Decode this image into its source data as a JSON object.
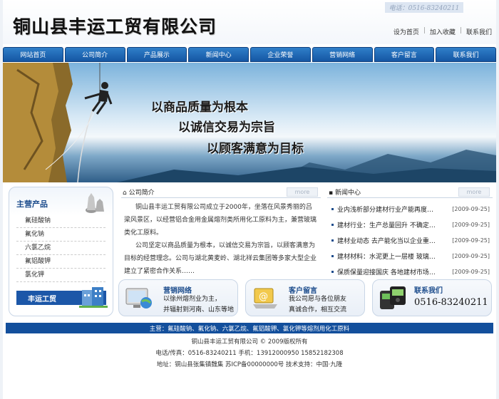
{
  "header": {
    "company_name": "铜山县丰运工贸有限公司",
    "phone_banner": "电话：0516-83240211",
    "top_links": [
      "设为首页",
      "加入收藏",
      "联系我们"
    ]
  },
  "nav": [
    "网站首页",
    "公司简介",
    "产品展示",
    "新闻中心",
    "企业荣誉",
    "营销网络",
    "客户留言",
    "联系我们"
  ],
  "banner": {
    "slogans": [
      "以商品质量为根本",
      "以诚信交易为宗旨",
      "以顾客满意为目标"
    ]
  },
  "products": {
    "title": "主营产品",
    "items": [
      "氟硅酸钠",
      "氟化钠",
      "六氯乙烷",
      "氟铝酸钾",
      "氯化钾"
    ],
    "logo_text": "丰运工贸"
  },
  "intro": {
    "title": "公司简介",
    "more": "more",
    "paragraphs": [
      "铜山县丰运工贸有限公司成立于2000年，坐落在风景秀丽的吕梁风景区，以经营铝合金用金属熔剂类所用化工原料为主，兼营玻璃类化工原料。",
      "公司坚定以商品质量为根本，以诚信交易为宗旨，以顾客满意为目标的经营理念。公司与湖北黄麦岭、湖北祥云集团等多家大型企业建立了紧密合作关系……"
    ]
  },
  "news": {
    "title": "新闻中心",
    "more": "more",
    "items": [
      {
        "title": "业内浅析部分建材行业产能再度过剩…",
        "date": "[2009-09-25]"
      },
      {
        "title": "建材行业：生产总量回升 不确定因…",
        "date": "[2009-09-25]"
      },
      {
        "title": "建材业动态 去产能化当以企业重组…",
        "date": "[2009-09-25]"
      },
      {
        "title": "建材材料：水泥更上一层楼 玻璃冰…",
        "date": "[2009-09-25]"
      },
      {
        "title": "保质保量迎接国庆 各地建材市场开…",
        "date": "[2009-09-25]"
      }
    ]
  },
  "boxes": {
    "marketing": {
      "title": "营销网络",
      "lines": [
        "以徐州熔剂业为主，",
        "并辐射到河南、山东等地"
      ]
    },
    "message": {
      "title": "客户留言",
      "lines": [
        "我公司愿与各位朋友",
        "真诚合作，相互交流"
      ]
    },
    "contact": {
      "title": "联系我们",
      "phone": "0516-83240211"
    }
  },
  "footer": {
    "bar": "主营：氟硅酸钠、氟化钠、六氯乙烷、氟铝酸钾、氯化钾等熔剂用化工原料",
    "lines": [
      "铜山县丰运工贸有限公司 © 2009版权所有",
      "电话/传真：0516-83240211 手机：13912000950 15852182308",
      "地址：铜山县张集镇魏集 苏ICP备00000000号 技术支持：中国·九隆"
    ]
  },
  "colors": {
    "nav": "#1a5fae",
    "accent": "#1c4c8c",
    "footer_bar": "#134f9c"
  }
}
